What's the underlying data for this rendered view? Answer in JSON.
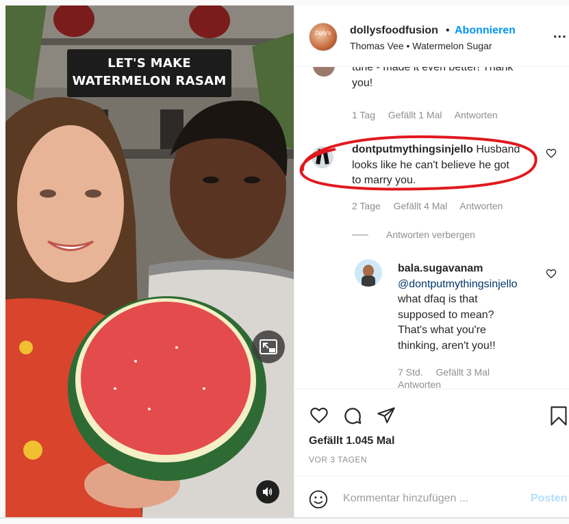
{
  "video": {
    "caption_line1": "LET'S MAKE",
    "caption_line2": "WATERMELON RASAM",
    "pip_icon": "picture-in-picture-icon",
    "sound_icon": "speaker-icon"
  },
  "header": {
    "username": "dollysfoodfusion",
    "separator": "•",
    "follow_label": "Abonnieren",
    "audio_info": "Thomas Vee • Watermelon Sugar",
    "more_label": "..."
  },
  "comments": [
    {
      "text_line1": "tune - made it even better! Thank",
      "text_line2": "you!",
      "time": "1 Tag",
      "likes": "Gefällt 1 Mal",
      "reply": "Antworten"
    },
    {
      "username": "dontputmythingsinjello",
      "text_first": "Husband",
      "text_line2": "looks like he can't believe he got",
      "text_line3": "to marry you.",
      "time": "2 Tage",
      "likes": "Gefällt 4 Mal",
      "reply": "Antworten",
      "hide_replies": "Antworten verbergen"
    },
    {
      "username": "bala.sugavanam",
      "mention": "@dontputmythingsinjello",
      "text_line1": "what dfaq is that",
      "text_line2": "supposed to mean?",
      "text_line3": "That's what you're",
      "text_line4": "thinking, aren't you!!",
      "time": "7 Std.",
      "likes": "Gefällt 3 Mal",
      "reply": "Antworten"
    }
  ],
  "actions": {
    "likes_count": "Gefällt 1.045 Mal",
    "post_age": "VOR 3 TAGEN",
    "comment_placeholder": "Kommentar hinzufügen ...",
    "post_label": "Posten"
  },
  "colors": {
    "accent": "#0095f6",
    "highlight_circle": "#e0191f",
    "meta_gray": "#8e8e8e"
  }
}
